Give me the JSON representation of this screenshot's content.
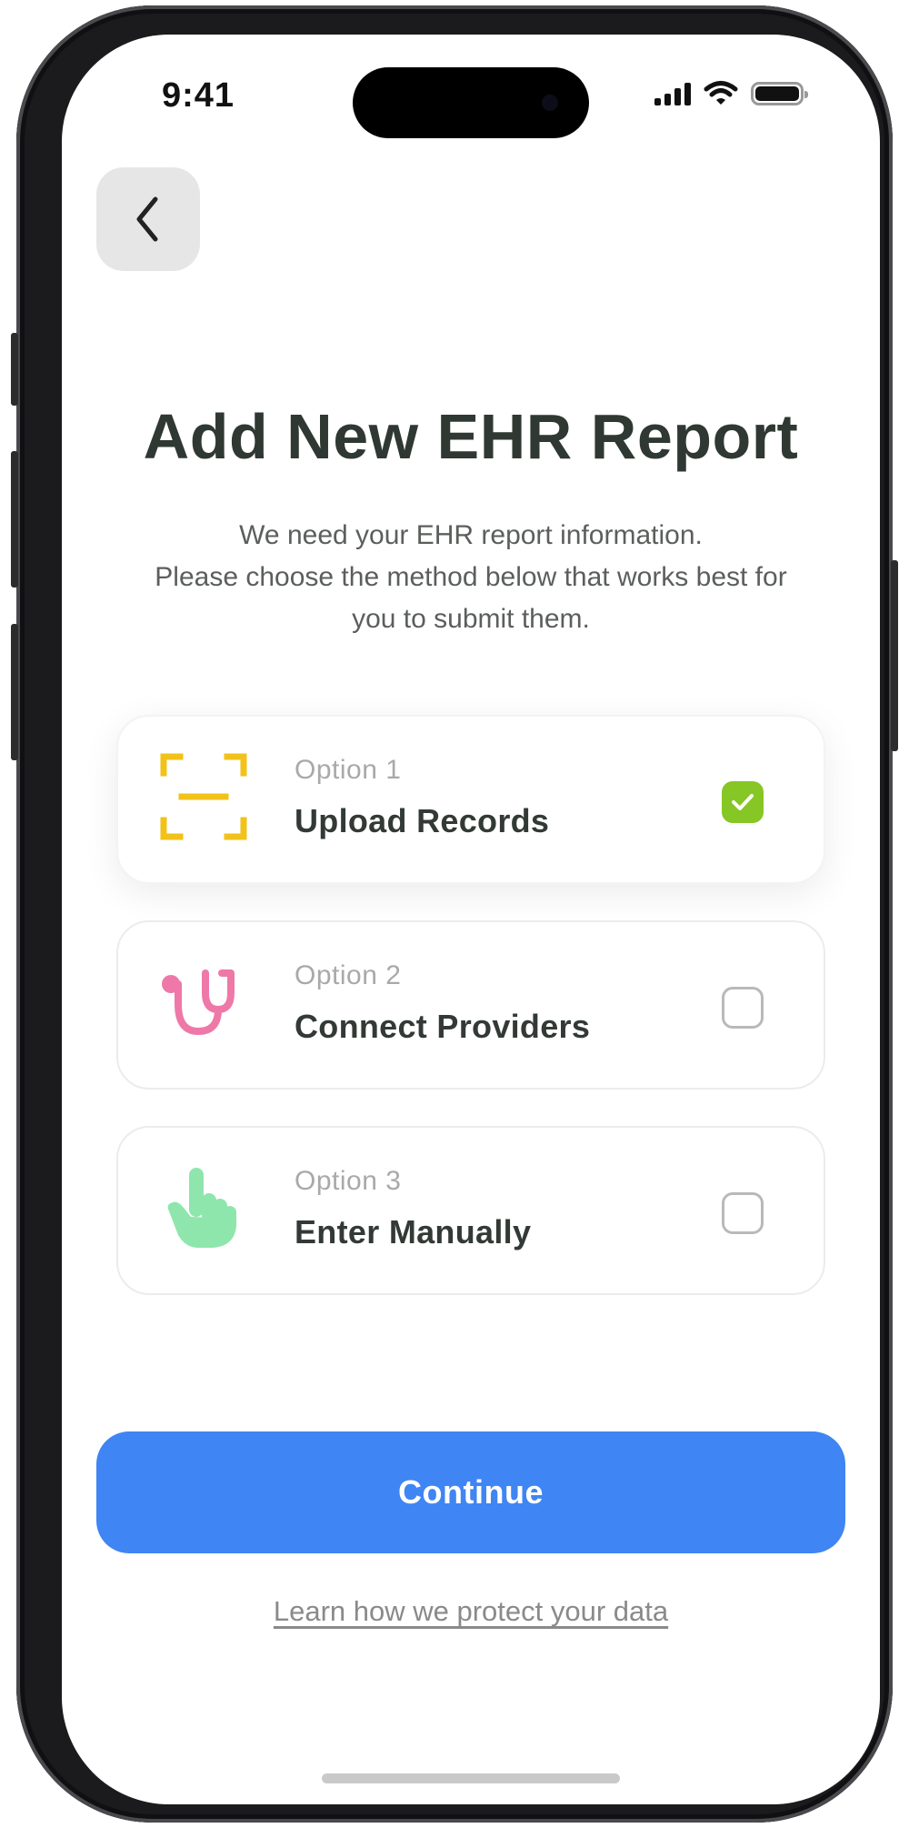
{
  "status_bar": {
    "time": "9:41"
  },
  "header": {
    "title": "Add New EHR Report",
    "subtitle_lines": [
      "We need your EHR report information.",
      "Please choose the method below that works best for",
      "you to submit them."
    ]
  },
  "options": [
    {
      "number_label": "Option 1",
      "title": "Upload Records",
      "icon": "scan-frame-icon",
      "icon_color": "#f2c21a",
      "selected": true
    },
    {
      "number_label": "Option 2",
      "title": "Connect Providers",
      "icon": "stethoscope-icon",
      "icon_color": "#ee79a8",
      "selected": false
    },
    {
      "number_label": "Option 3",
      "title": "Enter Manually",
      "icon": "hand-pointer-icon",
      "icon_color": "#8ee6ad",
      "selected": false
    }
  ],
  "footer": {
    "continue_label": "Continue",
    "learn_link": "Learn how we protect your data"
  },
  "colors": {
    "primary": "#3f85f3",
    "checked": "#86c625",
    "title": "#2f3833"
  }
}
